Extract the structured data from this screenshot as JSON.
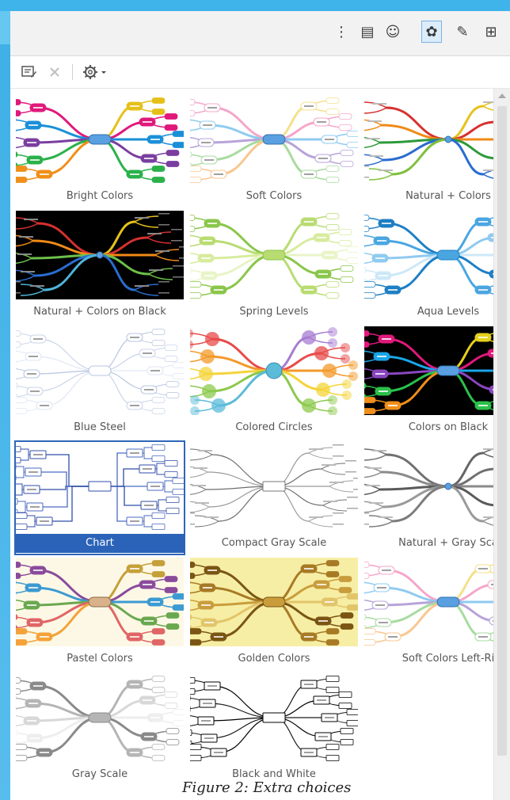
{
  "header_tools": [
    {
      "icon": "tree-layout-icon",
      "glyph": "⋮",
      "active": false
    },
    {
      "icon": "notes-icon",
      "glyph": "▤",
      "active": false
    },
    {
      "icon": "smiley-icon",
      "glyph": "☺",
      "active": false
    },
    {
      "icon": "palette-icon",
      "glyph": "✿",
      "active": true
    },
    {
      "icon": "pin-icon",
      "glyph": "✎",
      "active": false
    },
    {
      "icon": "presentation-icon",
      "glyph": "⊞",
      "active": false
    }
  ],
  "toolbar": {
    "edit_icon": "edit-style-icon",
    "delete_icon": "delete-icon",
    "settings_icon": "settings-dropdown-icon"
  },
  "gallery": {
    "selected": "Chart",
    "items": [
      {
        "label": "Bright Colors",
        "style": "bright",
        "bg": "#ffffff",
        "colors": [
          "#e0197b",
          "#1a8fd8",
          "#7a3ea0",
          "#2bb14a",
          "#f08f1a",
          "#e6c01a"
        ]
      },
      {
        "label": "Soft Colors",
        "style": "soft",
        "bg": "#ffffff",
        "colors": [
          "#f5a6c9",
          "#8fcbf0",
          "#b8a3d9",
          "#a8dba0",
          "#f8c78f",
          "#f4e08c"
        ]
      },
      {
        "label": "Natural + Colors",
        "style": "natural",
        "bg": "#ffffff",
        "colors": [
          "#d6312f",
          "#f08a17",
          "#2c9a3a",
          "#2a6ccf",
          "#7fbf3c",
          "#e5c21b"
        ]
      },
      {
        "label": "Natural + Colors on Black",
        "style": "natural",
        "bg": "#000000",
        "colors": [
          "#d6312f",
          "#f08a17",
          "#6cc04a",
          "#2a6ccf",
          "#4fb3d9",
          "#e5c21b"
        ]
      },
      {
        "label": "Spring Levels",
        "style": "boxes",
        "bg": "#ffffff",
        "colors": [
          "#8ac64a",
          "#b9dc72",
          "#d7ec9e",
          "#e9f4c8"
        ]
      },
      {
        "label": "Aqua Levels",
        "style": "boxes",
        "bg": "#ffffff",
        "colors": [
          "#1e7fc4",
          "#4aa6e1",
          "#8fcaf0",
          "#cde8f8"
        ]
      },
      {
        "label": "Blue Steel",
        "style": "outline",
        "bg": "#ffffff",
        "colors": [
          "#c9d4ea",
          "#dfe6f3",
          "#b8c5e0"
        ]
      },
      {
        "label": "Colored Circles",
        "style": "circles",
        "bg": "#ffffff",
        "colors": [
          "#e84a4a",
          "#f39a2a",
          "#f4d43a",
          "#8cc94c",
          "#5bbbd9",
          "#a77cd1"
        ]
      },
      {
        "label": "Colors on Black",
        "style": "bright",
        "bg": "#000000",
        "colors": [
          "#e0197b",
          "#1aa5e8",
          "#8a46c0",
          "#2bc14a",
          "#f08f1a",
          "#e6d01a"
        ]
      },
      {
        "label": "Chart",
        "style": "chart",
        "bg": "#ffffff",
        "colors": [
          "#2f4da8",
          "#4b6ac0"
        ]
      },
      {
        "label": "Compact Gray Scale",
        "style": "gray",
        "bg": "#ffffff",
        "colors": [
          "#6e6e6e",
          "#9a9a9a"
        ]
      },
      {
        "label": "Natural + Gray Sca",
        "style": "natural",
        "bg": "#ffffff",
        "colors": [
          "#707070",
          "#8a8a8a",
          "#5a5a5a",
          "#9a9a9a",
          "#7c7c7c",
          "#666666"
        ]
      },
      {
        "label": "Pastel Colors",
        "style": "pastel",
        "bg": "#fdf8e6",
        "colors": [
          "#8a4b9c",
          "#3c9ad2",
          "#6aa84f",
          "#e06666",
          "#f4a23a",
          "#c5a03a"
        ]
      },
      {
        "label": "Golden Colors",
        "style": "golden",
        "bg": "#f7eea5",
        "colors": [
          "#7a5513",
          "#a77a25",
          "#c99d3c",
          "#e2c56a"
        ]
      },
      {
        "label": "Soft Colors Left-Ri",
        "style": "soft",
        "bg": "#ffffff",
        "colors": [
          "#f5a6c9",
          "#8fcbf0",
          "#b8a3d9",
          "#a8dba0",
          "#f8c78f",
          "#f4e08c"
        ]
      },
      {
        "label": "Gray Scale",
        "style": "boxes",
        "bg": "#ffffff",
        "colors": [
          "#8a8a8a",
          "#b5b5b5",
          "#d8d8d8",
          "#eeeeee"
        ]
      },
      {
        "label": "Black and White",
        "style": "bw",
        "bg": "#ffffff",
        "colors": [
          "#000000",
          "#1a1a1a"
        ]
      }
    ]
  },
  "figure_caption": "Figure 2: Extra choices"
}
